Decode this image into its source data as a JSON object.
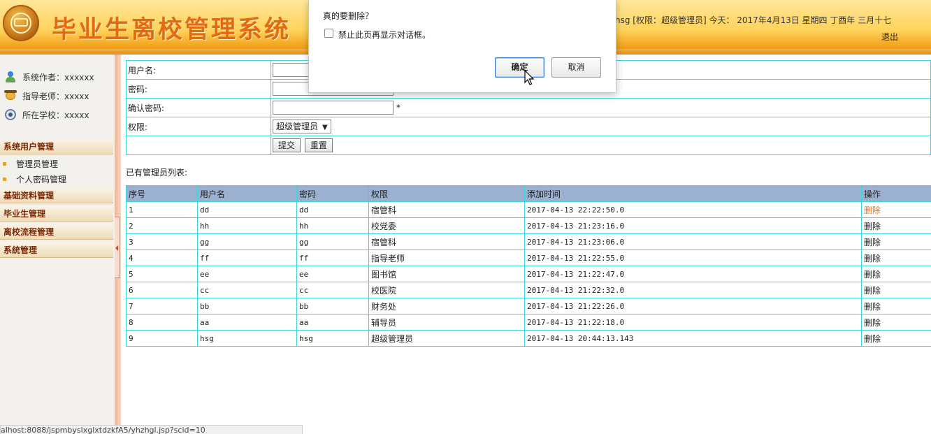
{
  "header": {
    "title": "毕业生离校管理系统",
    "user_info": "hsg [权限：超级管理员] 今天： 2017年4月13日  星期四  丁酉年 三月十七",
    "logout": "退出"
  },
  "sidebar": {
    "author": "系统作者：xxxxxx",
    "teacher": "指导老师：xxxxx",
    "school": "所在学校：xxxxx",
    "groups": [
      {
        "label": "系统用户管理",
        "items": [
          "管理员管理",
          "个人密码管理"
        ]
      },
      {
        "label": "基础资料管理"
      },
      {
        "label": "毕业生管理"
      },
      {
        "label": "离校流程管理"
      },
      {
        "label": "系统管理"
      }
    ]
  },
  "form": {
    "username_label": "用户名:",
    "password_label": "密码:",
    "confirm_label": "确认密码:",
    "role_label": "权限:",
    "required_mark": "*",
    "role_selected": "超级管理员",
    "submit": "提交",
    "reset": "重置"
  },
  "list": {
    "caption": "已有管理员列表:",
    "columns": [
      "序号",
      "用户名",
      "密码",
      "权限",
      "添加时间",
      "操作"
    ],
    "rows": [
      {
        "no": "1",
        "user": "dd",
        "pwd": "dd",
        "role": "宿管科",
        "time": "2017-04-13 22:22:50.0",
        "action": "删除"
      },
      {
        "no": "2",
        "user": "hh",
        "pwd": "hh",
        "role": "校党委",
        "time": "2017-04-13 21:23:16.0",
        "action": "删除"
      },
      {
        "no": "3",
        "user": "gg",
        "pwd": "gg",
        "role": "宿管科",
        "time": "2017-04-13 21:23:06.0",
        "action": "删除"
      },
      {
        "no": "4",
        "user": "ff",
        "pwd": "ff",
        "role": "指导老师",
        "time": "2017-04-13 21:22:55.0",
        "action": "删除"
      },
      {
        "no": "5",
        "user": "ee",
        "pwd": "ee",
        "role": "图书馆",
        "time": "2017-04-13 21:22:47.0",
        "action": "删除"
      },
      {
        "no": "6",
        "user": "cc",
        "pwd": "cc",
        "role": "校医院",
        "time": "2017-04-13 21:22:32.0",
        "action": "删除"
      },
      {
        "no": "7",
        "user": "bb",
        "pwd": "bb",
        "role": "财务处",
        "time": "2017-04-13 21:22:26.0",
        "action": "删除"
      },
      {
        "no": "8",
        "user": "aa",
        "pwd": "aa",
        "role": "辅导员",
        "time": "2017-04-13 21:22:18.0",
        "action": "删除"
      },
      {
        "no": "9",
        "user": "hsg",
        "pwd": "hsg",
        "role": "超级管理员",
        "time": "2017-04-13 20:44:13.143",
        "action": "删除"
      }
    ]
  },
  "dialog": {
    "message": "真的要删除？",
    "checkbox_label": "禁止此页再显示对话框。",
    "ok": "确定",
    "cancel": "取消"
  },
  "status_bar": "alhost:8088/jspmbyslxglxtdzkfA5/yhzhgl.jsp?scid=10",
  "colors": {
    "accent_orange": "#e16a12",
    "table_border": "#39d6e2",
    "table_header": "#9bb1cf",
    "hover_link": "#e07418"
  }
}
